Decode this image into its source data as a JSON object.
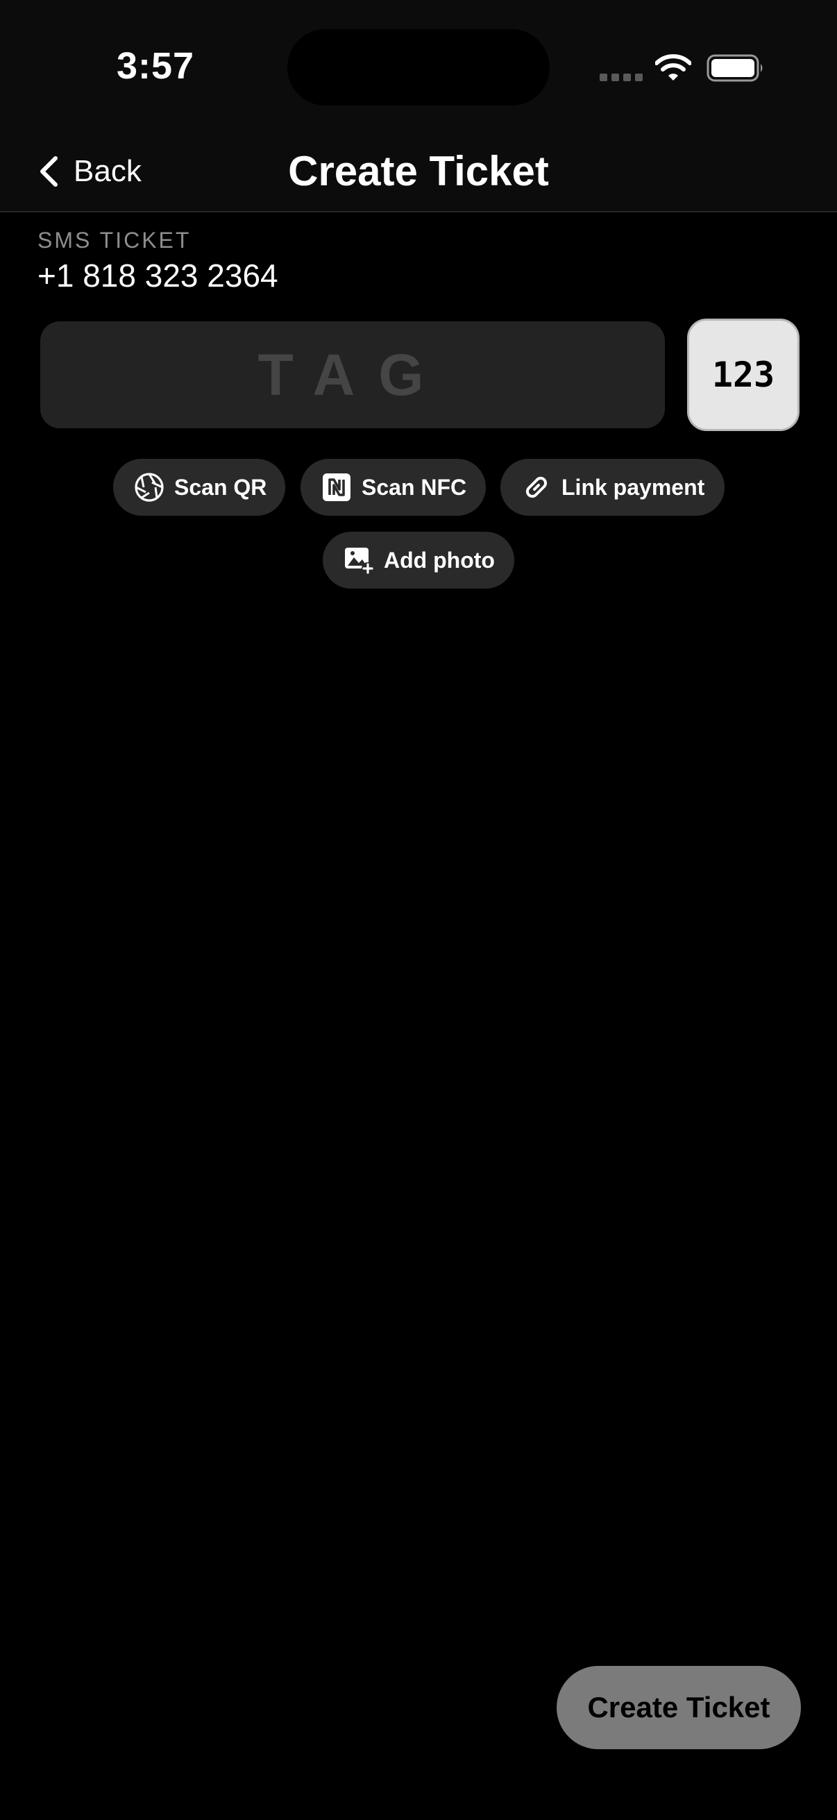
{
  "status_bar": {
    "time": "3:57",
    "icons": [
      "signal-icon",
      "wifi-icon",
      "battery-icon"
    ]
  },
  "nav": {
    "back_label": "Back",
    "title": "Create Ticket"
  },
  "ticket": {
    "type_label": "SMS TICKET",
    "phone": "+1 818 323 2364"
  },
  "tag_input": {
    "value": "",
    "placeholder": "TAG"
  },
  "keypad_toggle": {
    "label": "123"
  },
  "actions": [
    {
      "label": "Scan QR",
      "icon": "aperture-icon"
    },
    {
      "label": "Scan NFC",
      "icon": "nfc-icon"
    },
    {
      "label": "Link payment",
      "icon": "link-icon"
    },
    {
      "label": "Add photo",
      "icon": "add-photo-icon"
    }
  ],
  "create_button": {
    "label": "Create Ticket"
  },
  "colors": {
    "background": "#000000",
    "bar_background": "#0c0c0c",
    "chip_background": "#2a2a2a",
    "input_background": "#232323",
    "create_button": "#7b7b7b",
    "keypad_toggle": "#e6e6e6"
  }
}
